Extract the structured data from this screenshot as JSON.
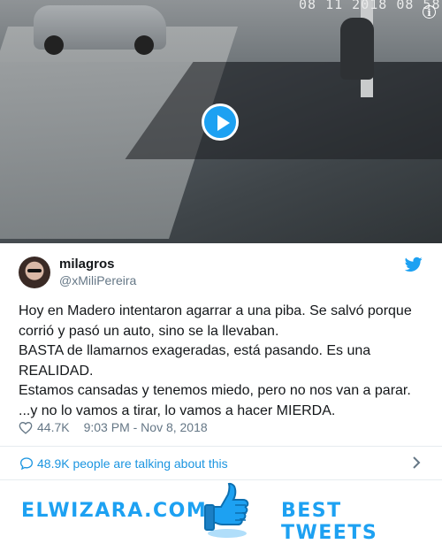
{
  "video": {
    "timestamp": "08 11 2018 08 58",
    "play_icon": "play-icon",
    "info_icon": "info-icon",
    "info_glyph": "i"
  },
  "tweet": {
    "display_name": "milagros",
    "handle": "@xMiliPereira",
    "text_lines": [
      "Hoy en Madero intentaron agarrar a una piba. Se salvó porque",
      "corrió y pasó un auto, sino se la llevaban.",
      "BASTA de llamarnos exageradas, está pasando. Es una",
      "REALIDAD.",
      "Estamos cansadas y tenemos miedo, pero no nos van a parar.",
      "...y no lo vamos a tirar, lo vamos a hacer MIERDA."
    ],
    "likes": "44.7K",
    "time": "9:03 PM - Nov 8, 2018",
    "talking": "48.9K people are talking about this"
  },
  "footer": {
    "brand_left": "ELWIZARA.COM",
    "brand_right": "BEST TWEETS"
  },
  "colors": {
    "accent": "#1da1f2",
    "link": "#1b95e0",
    "muted": "#657786",
    "text": "#14171a"
  }
}
